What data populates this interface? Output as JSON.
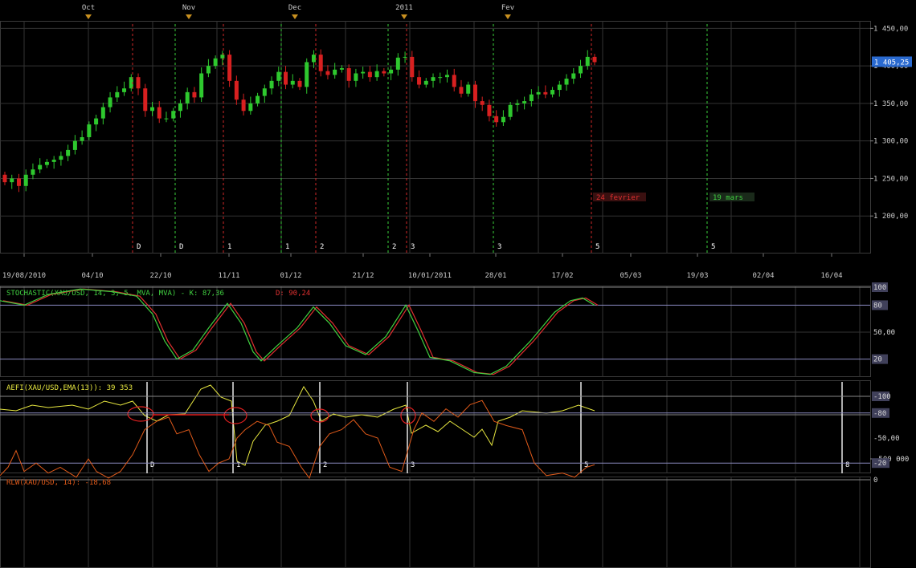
{
  "top_months": [
    "Oct",
    "Nov",
    "Dec",
    "2011",
    "Fev"
  ],
  "price_axis": {
    "ticks": [
      "1 450,00",
      "1 400,00",
      "1 350,00",
      "1 300,00",
      "1 250,00",
      "1 200,00"
    ],
    "current": "1 405,25"
  },
  "date_axis": [
    "19/08/2010",
    "04/10",
    "22/10",
    "11/11",
    "01/12",
    "21/12",
    "10/01/2011",
    "28/01",
    "17/02",
    "05/03",
    "19/03",
    "02/04",
    "16/04"
  ],
  "vlines": [
    {
      "label": "D",
      "color": "#d02828"
    },
    {
      "label": "D",
      "color": "#3ad03a"
    },
    {
      "label": "1",
      "color": "#d02828"
    },
    {
      "label": "1",
      "color": "#3ad03a"
    },
    {
      "label": "2",
      "color": "#d02828"
    },
    {
      "label": "2",
      "color": "#3ad03a"
    },
    {
      "label": "3",
      "color": "#d02828"
    },
    {
      "label": "3",
      "color": "#3ad03a"
    },
    {
      "label": "5",
      "color": "#d02828"
    },
    {
      "label": "5",
      "color": "#3ad03a"
    }
  ],
  "annotations": [
    {
      "text": "24 fevrier",
      "color": "#e03030"
    },
    {
      "text": "19 mars",
      "color": "#40d040"
    }
  ],
  "stoch": {
    "title": "STOCHASTIC(XAU/USD, 14, 3, 5, MVA, MVA) - K: 87,36",
    "d_text": "D: 90,24",
    "ticks": [
      "100",
      "80",
      "50,00",
      "20"
    ]
  },
  "aefi": {
    "title": "AEFI(XAU/USD,EMA(13)): 39 353",
    "ticks": [
      "0",
      "-500 000"
    ],
    "markers": [
      "D",
      "1",
      "2",
      "3",
      "5",
      "8"
    ]
  },
  "rlw": {
    "title": "RLW(XAU/USD, 14): -18,68",
    "ticks": [
      "0",
      "-20",
      "-50,00",
      "-80",
      "-100"
    ]
  },
  "chart_data": [
    {
      "type": "candlestick",
      "title": "XAU/USD",
      "close": [
        1245,
        1250,
        1240,
        1255,
        1262,
        1268,
        1272,
        1275,
        1280,
        1288,
        1300,
        1305,
        1322,
        1330,
        1345,
        1358,
        1365,
        1370,
        1385,
        1370,
        1340,
        1345,
        1330,
        1330,
        1340,
        1350,
        1365,
        1358,
        1390,
        1400,
        1410,
        1415,
        1380,
        1355,
        1340,
        1350,
        1360,
        1370,
        1380,
        1392,
        1375,
        1380,
        1372,
        1405,
        1415,
        1393,
        1388,
        1395,
        1397,
        1380,
        1390,
        1392,
        1385,
        1393,
        1390,
        1395,
        1411,
        1412,
        1385,
        1375,
        1380,
        1385,
        1385,
        1388,
        1372,
        1363,
        1375,
        1353,
        1348,
        1333,
        1325,
        1332,
        1348,
        1350,
        1353,
        1362,
        1365,
        1362,
        1368,
        1375,
        1383,
        1390,
        1400,
        1412,
        1405
      ],
      "y_range": [
        1150,
        1460
      ]
    },
    {
      "type": "line",
      "title": "STOCHASTIC(XAU/USD, 14, 3, 5, MVA, MVA)",
      "series": [
        {
          "name": "K",
          "color": "#e03030"
        },
        {
          "name": "D",
          "color": "#40d040"
        }
      ],
      "last": {
        "K": 87.36,
        "D": 90.24
      },
      "y_range": [
        0,
        100
      ]
    },
    {
      "type": "line",
      "title": "AEFI(XAU/USD,EMA(13))",
      "series": [
        {
          "name": "AEFI",
          "color": "#e8e840"
        }
      ],
      "last": 39353
    },
    {
      "type": "line",
      "title": "RLW(XAU/USD, 14)",
      "series": [
        {
          "name": "RLW",
          "color": "#e05a1a"
        }
      ],
      "last": -18.68,
      "y_range": [
        -100,
        0
      ]
    }
  ]
}
